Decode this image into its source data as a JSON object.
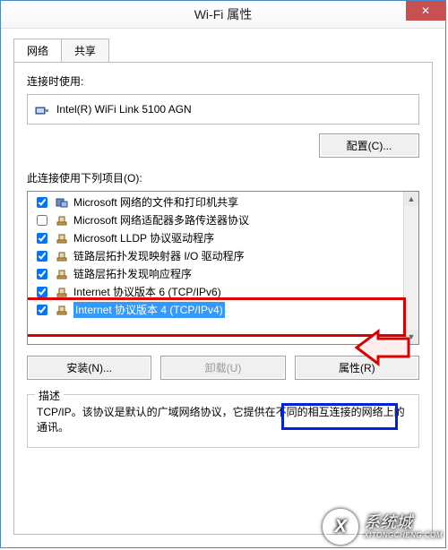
{
  "window": {
    "title": "Wi-Fi 属性",
    "close_glyph": "✕"
  },
  "tabs": {
    "network": "网络",
    "sharing": "共享"
  },
  "connect_using_label": "连接时使用:",
  "adapter_name": "Intel(R) WiFi Link 5100 AGN",
  "configure_btn": "配置(C)...",
  "items_label": "此连接使用下列项目(O):",
  "items": [
    {
      "checked": true,
      "label": "Microsoft 网络的文件和打印机共享",
      "icon": "net"
    },
    {
      "checked": false,
      "label": "Microsoft 网络适配器多路传送器协议",
      "icon": "proto"
    },
    {
      "checked": true,
      "label": "Microsoft LLDP 协议驱动程序",
      "icon": "proto"
    },
    {
      "checked": true,
      "label": "链路层拓扑发现映射器 I/O 驱动程序",
      "icon": "proto"
    },
    {
      "checked": true,
      "label": "链路层拓扑发现响应程序",
      "icon": "proto"
    },
    {
      "checked": true,
      "label": "Internet 协议版本 6 (TCP/IPv6)",
      "icon": "proto"
    },
    {
      "checked": true,
      "label": "Internet 协议版本 4 (TCP/IPv4)",
      "icon": "proto",
      "selected": true
    }
  ],
  "buttons": {
    "install": "安装(N)...",
    "uninstall": "卸载(U)",
    "properties": "属性(R)"
  },
  "description": {
    "legend": "描述",
    "text": "TCP/IP。该协议是默认的广域网络协议，它提供在不同的相互连接的网络上的通讯。"
  },
  "watermark": {
    "glyph": "X",
    "cn": "系统城",
    "en": "XITONGCHENG.COM"
  },
  "colors": {
    "highlight_red": "#d80000",
    "highlight_blue": "#0022d8"
  }
}
